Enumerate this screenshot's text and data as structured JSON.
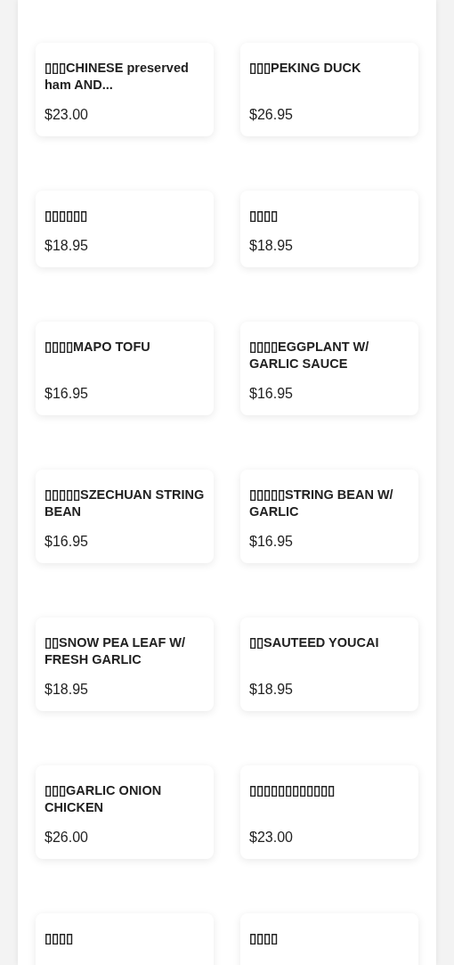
{
  "menu_items": [
    {
      "name": "▯▯▯CHINESE preserved ham AND...",
      "price": "$23.00"
    },
    {
      "name": "▯▯▯PEKING DUCK",
      "price": "$26.95"
    },
    {
      "name": "▯▯▯▯▯▯",
      "price": "$18.95"
    },
    {
      "name": "▯▯▯▯",
      "price": "$18.95"
    },
    {
      "name": "▯▯▯▯MAPO TOFU",
      "price": "$16.95"
    },
    {
      "name": "▯▯▯▯EGGPLANT W/ GARLIC SAUCE",
      "price": "$16.95"
    },
    {
      "name": "▯▯▯▯▯SZECHUAN STRING BEAN",
      "price": "$16.95"
    },
    {
      "name": "▯▯▯▯▯STRING BEAN W/ GARLIC",
      "price": "$16.95"
    },
    {
      "name": "▯▯SNOW PEA LEAF W/ FRESH GARLIC",
      "price": "$18.95"
    },
    {
      "name": "▯▯SAUTEED YOUCAI",
      "price": "$18.95"
    },
    {
      "name": "▯▯▯GARLIC ONION CHICKEN",
      "price": "$26.00"
    },
    {
      "name": "▯▯▯▯▯▯▯▯▯▯▯▯",
      "price": "$23.00"
    },
    {
      "name": "▯▯▯▯"
    },
    {
      "name": "▯▯▯▯"
    }
  ]
}
